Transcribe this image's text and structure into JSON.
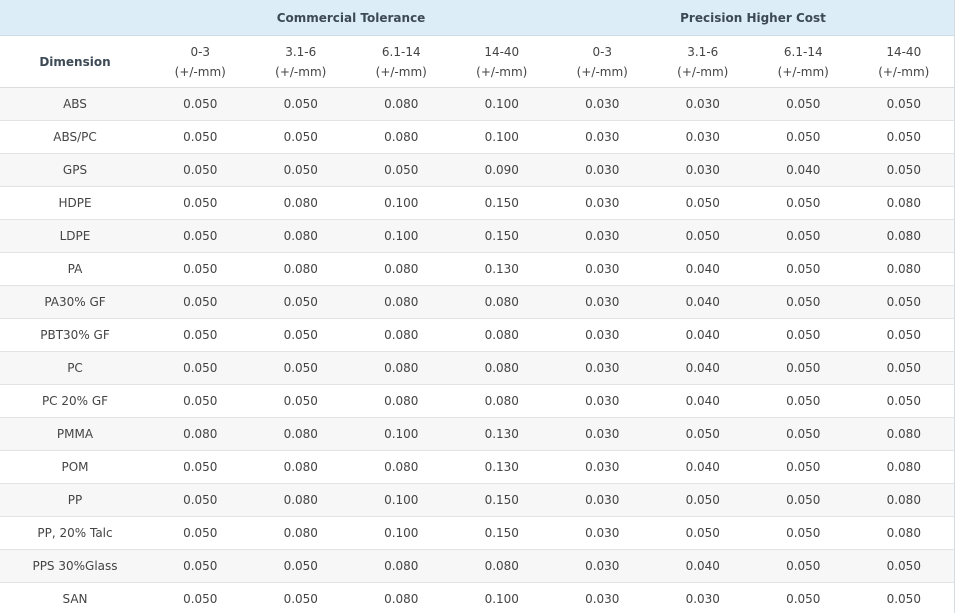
{
  "groups": {
    "blank": "",
    "commercial": "Commercial Tolerance",
    "precision": "Precision Higher Cost"
  },
  "header": {
    "dimension": "Dimension",
    "unit": "(+/-mm)",
    "ranges": [
      "0-3",
      "3.1-6",
      "6.1-14",
      "14-40",
      "0-3",
      "3.1-6",
      "6.1-14",
      "14-40"
    ]
  },
  "rows": [
    {
      "material": "ABS",
      "values": [
        "0.050",
        "0.050",
        "0.080",
        "0.100",
        "0.030",
        "0.030",
        "0.050",
        "0.050"
      ]
    },
    {
      "material": "ABS/PC",
      "values": [
        "0.050",
        "0.050",
        "0.080",
        "0.100",
        "0.030",
        "0.030",
        "0.050",
        "0.050"
      ]
    },
    {
      "material": "GPS",
      "values": [
        "0.050",
        "0.050",
        "0.050",
        "0.090",
        "0.030",
        "0.030",
        "0.040",
        "0.050"
      ]
    },
    {
      "material": "HDPE",
      "values": [
        "0.050",
        "0.080",
        "0.100",
        "0.150",
        "0.030",
        "0.050",
        "0.050",
        "0.080"
      ]
    },
    {
      "material": "LDPE",
      "values": [
        "0.050",
        "0.080",
        "0.100",
        "0.150",
        "0.030",
        "0.050",
        "0.050",
        "0.080"
      ]
    },
    {
      "material": "PA",
      "values": [
        "0.050",
        "0.080",
        "0.080",
        "0.130",
        "0.030",
        "0.040",
        "0.050",
        "0.080"
      ]
    },
    {
      "material": "PA30% GF",
      "values": [
        "0.050",
        "0.050",
        "0.080",
        "0.080",
        "0.030",
        "0.040",
        "0.050",
        "0.050"
      ]
    },
    {
      "material": "PBT30% GF",
      "values": [
        "0.050",
        "0.050",
        "0.080",
        "0.080",
        "0.030",
        "0.040",
        "0.050",
        "0.050"
      ]
    },
    {
      "material": "PC",
      "values": [
        "0.050",
        "0.050",
        "0.080",
        "0.080",
        "0.030",
        "0.040",
        "0.050",
        "0.050"
      ]
    },
    {
      "material": "PC 20% GF",
      "values": [
        "0.050",
        "0.050",
        "0.080",
        "0.080",
        "0.030",
        "0.040",
        "0.050",
        "0.050"
      ]
    },
    {
      "material": "PMMA",
      "values": [
        "0.080",
        "0.080",
        "0.100",
        "0.130",
        "0.030",
        "0.050",
        "0.050",
        "0.080"
      ]
    },
    {
      "material": "POM",
      "values": [
        "0.050",
        "0.080",
        "0.080",
        "0.130",
        "0.030",
        "0.040",
        "0.050",
        "0.080"
      ]
    },
    {
      "material": "PP",
      "values": [
        "0.050",
        "0.080",
        "0.100",
        "0.150",
        "0.030",
        "0.050",
        "0.050",
        "0.080"
      ]
    },
    {
      "material": "PP, 20% Talc",
      "values": [
        "0.050",
        "0.080",
        "0.100",
        "0.150",
        "0.030",
        "0.050",
        "0.050",
        "0.080"
      ]
    },
    {
      "material": "PPS 30%Glass",
      "values": [
        "0.050",
        "0.050",
        "0.080",
        "0.080",
        "0.030",
        "0.040",
        "0.050",
        "0.050"
      ]
    },
    {
      "material": "SAN",
      "values": [
        "0.050",
        "0.050",
        "0.080",
        "0.100",
        "0.030",
        "0.030",
        "0.050",
        "0.050"
      ]
    }
  ]
}
